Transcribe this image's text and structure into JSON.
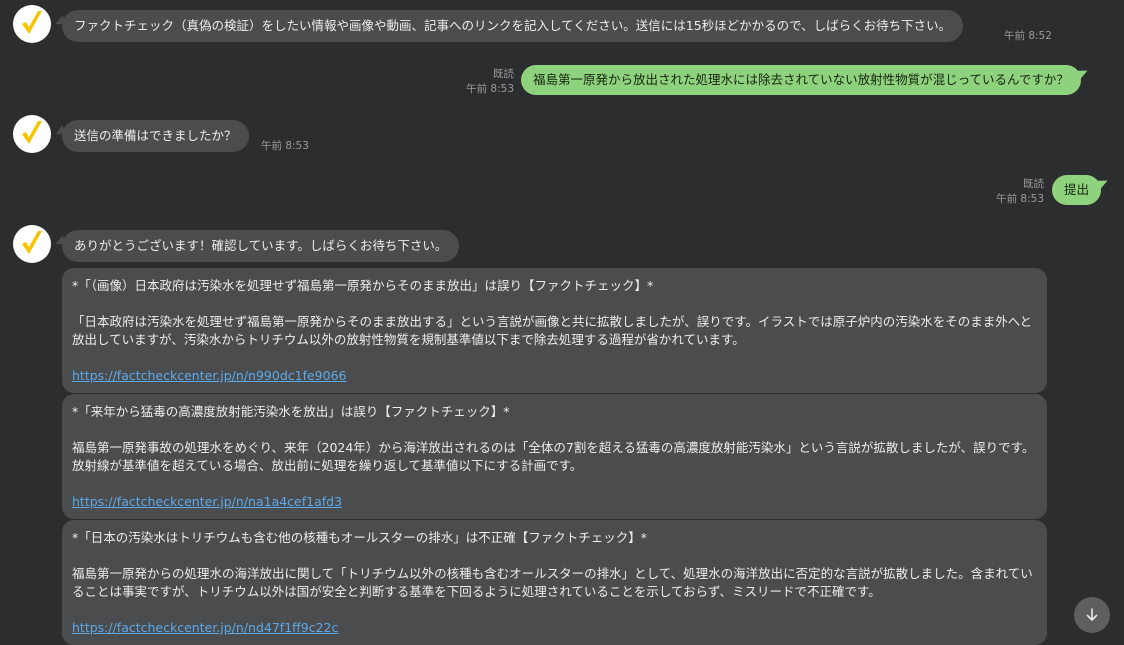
{
  "colors": {
    "background": "#2c2d2f",
    "incoming_bubble": "#4b4c4e",
    "outgoing_bubble": "#8fd27e",
    "link": "#5da9e9",
    "avatar_check": "#f5c400"
  },
  "messages": {
    "m1": {
      "text": "ファクトチェック（真偽の検証）をしたい情報や画像や動画、記事へのリンクを記入してください。送信には15秒ほどかかるので、しばらくお待ち下さい。",
      "time": "午前 8:52"
    },
    "m2": {
      "text": "福島第一原発から放出された処理水には除去されていない放射性物質が混じっているんですか？",
      "read": "既読",
      "time": "午前 8:53"
    },
    "m3": {
      "text": "送信の準備はできましたか？",
      "time": "午前 8:53"
    },
    "m4": {
      "text": "提出",
      "read": "既読",
      "time": "午前 8:53"
    },
    "m5": {
      "text": "ありがとうございます！確認しています。しばらくお待ち下さい。"
    }
  },
  "results": [
    {
      "title": "*「（画像）日本政府は汚染水を処理せず福島第一原発からそのまま放出」は誤り【ファクトチェック】*",
      "body": "「日本政府は汚染水を処理せず福島第一原発からそのまま放出する」という言説が画像と共に拡散しましたが、誤りです。イラストでは原子炉内の汚染水をそのまま外へと放出していますが、汚染水からトリチウム以外の放射性物質を規制基準値以下まで除去処理する過程が省かれています。",
      "link": "https://factcheckcenter.jp/n/n990dc1fe9066"
    },
    {
      "title": "*「来年から猛毒の高濃度放射能汚染水を放出」は誤り【ファクトチェック】*",
      "body": "福島第一原発事故の処理水をめぐり、来年（2024年）から海洋放出されるのは「全体の7割を超える猛毒の高濃度放射能汚染水」という言説が拡散しましたが、誤りです。放射線が基準値を超えている場合、放出前に処理を繰り返して基準値以下にする計画です。",
      "link": "https://factcheckcenter.jp/n/na1a4cef1afd3"
    },
    {
      "title": "*「日本の汚染水はトリチウムも含む他の核種もオールスターの排水」は不正確【ファクトチェック】*",
      "body": "福島第一原発からの処理水の海洋放出に関して「トリチウム以外の核種も含むオールスターの排水」として、処理水の海洋放出に否定的な言説が拡散しました。含まれていることは事実ですが、トリチウム以外は国が安全と判断する基準を下回るように処理されていることを示しておらず、ミスリードで不正確です。",
      "link": "https://factcheckcenter.jp/n/nd47f1ff9c22c"
    }
  ],
  "icons": {
    "avatar": "check-logo-icon",
    "scroll": "arrow-down-icon"
  }
}
